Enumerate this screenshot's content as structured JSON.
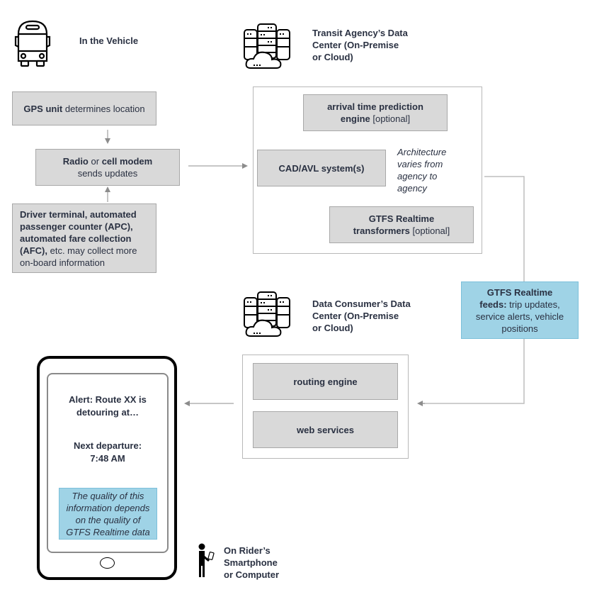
{
  "sections": {
    "vehicle": {
      "title": "In the Vehicle",
      "icon": "bus-icon"
    },
    "agency": {
      "title_lines": [
        "Transit Agency’s Data",
        "Center (On-Premise",
        "or Cloud)"
      ],
      "icon": "server-cloud-icon"
    },
    "consumer": {
      "title_lines": [
        "Data Consumer’s Data",
        "Center (On-Premise",
        "or Cloud)"
      ],
      "icon": "server-cloud-icon"
    },
    "rider": {
      "title_lines": [
        "On Rider’s",
        "Smartphone",
        "or Computer"
      ],
      "icon": "person-with-phone-icon"
    }
  },
  "vehicle_boxes": {
    "gps": {
      "bold": "GPS unit",
      "rest": " determines location"
    },
    "radio": {
      "bold1": "Radio",
      "mid": " or ",
      "bold2": "cell modem",
      "line2": "sends updates"
    },
    "driver": {
      "bold_lines": [
        "Driver terminal, automated",
        "passenger counter (APC),",
        "automated fare collection"
      ],
      "bold_tail": "(AFC),",
      "rest_tail": " etc. may collect more",
      "last_line": "on-board information"
    }
  },
  "agency_boxes": {
    "prediction": {
      "bold_line1": "arrival time prediction",
      "bold_line2": "engine",
      "rest": " [optional]"
    },
    "cad": {
      "label": "CAD/AVL system(s)"
    },
    "note_lines": [
      "Architecture",
      "varies from",
      "agency to",
      "agency"
    ],
    "transformers": {
      "bold_line1": "GTFS Realtime",
      "bold_line2": "transformers",
      "rest": " [optional]"
    }
  },
  "feeds": {
    "bold_line1": "GTFS Realtime",
    "bold_line2": "feeds:",
    "rest2": " trip updates,",
    "line3": "service alerts, vehicle",
    "line4": "positions"
  },
  "consumer_boxes": {
    "routing": "routing engine",
    "web": "web services"
  },
  "phone": {
    "alert_lines": [
      "Alert: Route XX is",
      "detouring at…"
    ],
    "departure_lines": [
      "Next departure:",
      "7:48 AM"
    ],
    "quality_note_lines": [
      "The quality of this",
      "information depends",
      "on the quality of",
      "GTFS Realtime data"
    ]
  },
  "colors": {
    "box_gray": "#d9d9d9",
    "feed_blue": "#9fd3e6",
    "arrow_gray": "#8c8c8c",
    "text_dark": "#2a3142"
  }
}
